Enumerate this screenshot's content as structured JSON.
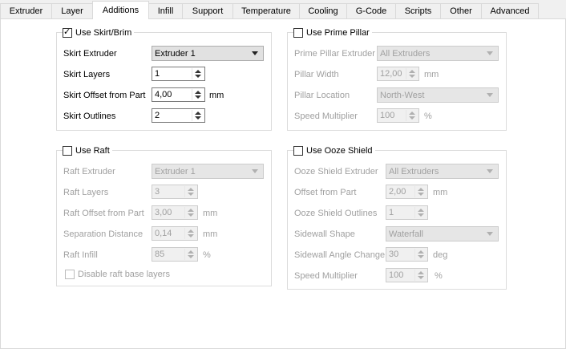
{
  "tabs": [
    "Extruder",
    "Layer",
    "Additions",
    "Infill",
    "Support",
    "Temperature",
    "Cooling",
    "G-Code",
    "Scripts",
    "Other",
    "Advanced"
  ],
  "active_tab": "Additions",
  "skirt": {
    "title": "Use Skirt/Brim",
    "checked": true,
    "extruder_label": "Skirt Extruder",
    "extruder_value": "Extruder 1",
    "layers_label": "Skirt Layers",
    "layers_value": "1",
    "offset_label": "Skirt Offset from Part",
    "offset_value": "4,00",
    "offset_unit": "mm",
    "outlines_label": "Skirt Outlines",
    "outlines_value": "2"
  },
  "prime": {
    "title": "Use Prime Pillar",
    "checked": false,
    "extruder_label": "Prime Pillar Extruder",
    "extruder_value": "All Extruders",
    "width_label": "Pillar Width",
    "width_value": "12,00",
    "width_unit": "mm",
    "location_label": "Pillar Location",
    "location_value": "North-West",
    "speed_label": "Speed Multiplier",
    "speed_value": "100",
    "speed_unit": "%"
  },
  "raft": {
    "title": "Use Raft",
    "checked": false,
    "extruder_label": "Raft Extruder",
    "extruder_value": "Extruder 1",
    "layers_label": "Raft Layers",
    "layers_value": "3",
    "offset_label": "Raft Offset from Part",
    "offset_value": "3,00",
    "offset_unit": "mm",
    "separation_label": "Separation Distance",
    "separation_value": "0,14",
    "separation_unit": "mm",
    "infill_label": "Raft Infill",
    "infill_value": "85",
    "infill_unit": "%",
    "disable_base_label": "Disable raft base layers"
  },
  "ooze": {
    "title": "Use Ooze Shield",
    "checked": false,
    "extruder_label": "Ooze Shield Extruder",
    "extruder_value": "All Extruders",
    "offset_label": "Offset from Part",
    "offset_value": "2,00",
    "offset_unit": "mm",
    "outlines_label": "Ooze Shield Outlines",
    "outlines_value": "1",
    "shape_label": "Sidewall Shape",
    "shape_value": "Waterfall",
    "angle_label": "Sidewall Angle Change",
    "angle_value": "30",
    "angle_unit": "deg",
    "speed_label": "Speed Multiplier",
    "speed_value": "100",
    "speed_unit": "%"
  }
}
